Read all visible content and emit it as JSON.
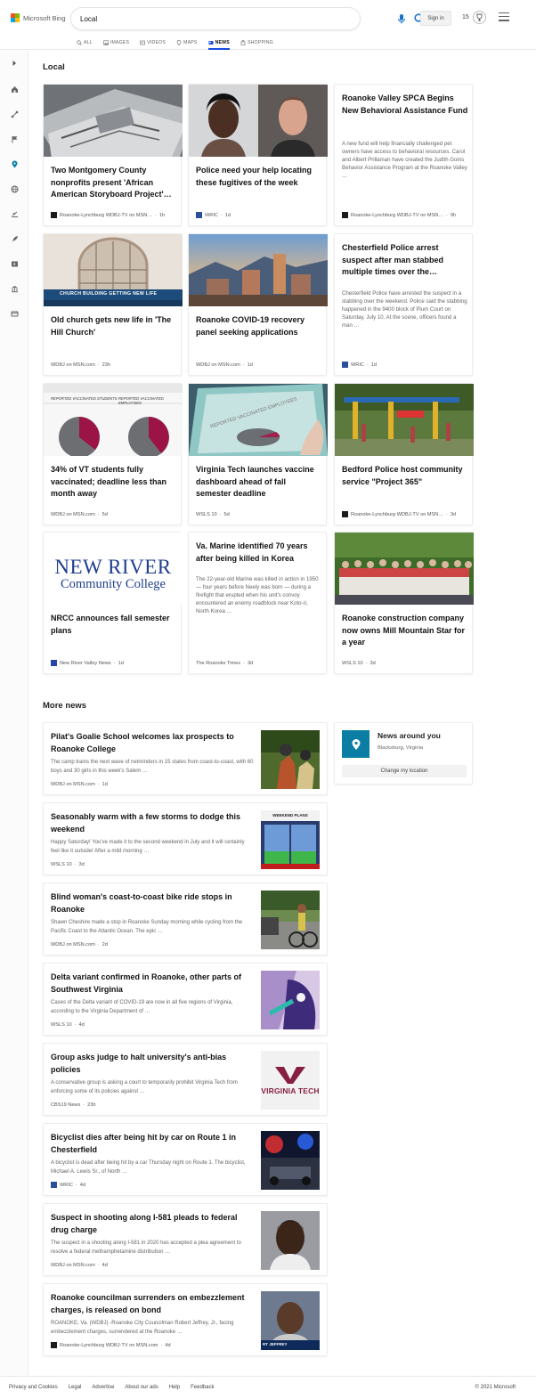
{
  "brand": {
    "name": "Microsoft Bing"
  },
  "search": {
    "query": "Local"
  },
  "header": {
    "signin_label": "Sign in",
    "rewards_count": "15"
  },
  "tabs": [
    {
      "label": "ALL",
      "icon": "search-icon"
    },
    {
      "label": "IMAGES",
      "icon": "image-icon"
    },
    {
      "label": "VIDEOS",
      "icon": "video-icon"
    },
    {
      "label": "MAPS",
      "icon": "map-pin-icon"
    },
    {
      "label": "NEWS",
      "icon": "news-icon",
      "active": true
    },
    {
      "label": "SHOPPING",
      "icon": "shopping-bag-icon"
    }
  ],
  "sidebar": {
    "icons": [
      "expand-icon",
      "home-icon",
      "science-icon",
      "flag-icon",
      "location-icon",
      "globe-icon",
      "education-icon",
      "rocket-icon",
      "video-play-icon",
      "bank-icon",
      "card-icon"
    ]
  },
  "sections": {
    "local": "Local",
    "more_news": "More news"
  },
  "cards": [
    {
      "title": "Two Montgomery County nonprofits present 'African American Storyboard Project'…",
      "source": "Roanoke-Lynchburg WDBJ-TV on MSN…",
      "age": "1h"
    },
    {
      "title": "Police need your help locating these fugitives of the week",
      "source": "WRIC",
      "age": "1d"
    },
    {
      "title": "Roanoke Valley SPCA Begins New Behavioral Assistance Fund",
      "snippet": "A new fund will help financially challenged pet owners have access to behavioral resources. Carol and Albert Prillaman have created the Judith Goins Behavior Assistance Program at the Roanoke Valley …",
      "source": "Roanoke-Lynchburg WDBJ-TV on MSN…",
      "age": "9h"
    },
    {
      "title": "Old church gets new life in 'The Hill Church'",
      "source": "WDBJ on MSN.com",
      "age": "23h",
      "img_caption": "CHURCH BUILDING GETTING NEW LIFE"
    },
    {
      "title": "Roanoke COVID-19 recovery panel seeking applications",
      "source": "WDBJ on MSN.com",
      "age": "1d"
    },
    {
      "title": "Chesterfield Police arrest suspect after man stabbed multiple times over the…",
      "snippet": "Chesterfield Police have arrested the suspect in a stabbing over the weekend. Police said the stabbing happened in the 9400 block of Plum Court on Saturday, July 10. At the scene, officers found a man …",
      "source": "WRIC",
      "age": "1d"
    },
    {
      "title": "34% of VT students fully vaccinated; deadline less than month away",
      "source": "WDBJ on MSN.com",
      "age": "5d",
      "img_label_a": "REPORTED VACCINATED STUDENTS",
      "img_label_b": "REPORTED VACCINATED EMPLOYEES"
    },
    {
      "title": "Virginia Tech launches vaccine dashboard ahead of fall semester deadline",
      "source": "WSLS 10",
      "age": "5d",
      "img_label": "REPORTED VACCINATED EMPLOYEES"
    },
    {
      "title": "Bedford Police host community service \"Project 365\"",
      "source": "Roanoke-Lynchburg WDBJ-TV on MSN…",
      "age": "3d"
    },
    {
      "title": "NRCC announces fall semester plans",
      "source": "New River Valley News",
      "age": "1d",
      "logo_line1": "NEW RIVER",
      "logo_line2": "Community College"
    },
    {
      "title": "Va. Marine identified 70 years after being killed in Korea",
      "snippet": "The 22-year-old Marine was killed in action in 1950 — four years before Neely was born — during a firefight that erupted when his unit's convoy encountered an enemy roadblock near Koto-ri, North Korea …",
      "source": "The Roanoke Times",
      "age": "3d"
    },
    {
      "title": "Roanoke construction company now owns Mill Mountain Star for a year",
      "source": "WSLS 10",
      "age": "3d"
    }
  ],
  "more_news": [
    {
      "title": "Pilat's Goalie School welcomes lax prospects to Roanoke College",
      "snippet": "The camp trains the next wave of netminders in 15 states from coast-to-coast, with 60 boys and 30 girls in this week's Salem …",
      "source": "WDBJ on MSN.com",
      "age": "1d"
    },
    {
      "title": "Seasonably warm with a few storms to dodge this weekend",
      "snippet": "Happy Saturday! You've made it to the second weekend in July and it will certainly feel like it outside! After a mild morning …",
      "source": "WSLS 10",
      "age": "3d",
      "thumb_label": "WEEKEND PLANS"
    },
    {
      "title": "Blind woman's coast-to-coast bike ride stops in Roanoke",
      "snippet": "Shawn Cheshire made a stop in Roanoke Sunday morning while cycling from the Pacific Coast to the Atlantic Ocean. The epic …",
      "source": "WDBJ on MSN.com",
      "age": "2d"
    },
    {
      "title": "Delta variant confirmed in Roanoke, other parts of Southwest Virginia",
      "snippet": "Cases of the Delta variant of COVID-19 are now in all five regions of Virginia, according to the Virginia Department of …",
      "source": "WSLS 10",
      "age": "4d"
    },
    {
      "title": "Group asks judge to halt university's anti-bias policies",
      "snippet": "A conservative group is asking a court to temporarily prohibit Virginia Tech from enforcing some of its policies against …",
      "source": "CBS19 News",
      "age": "23h",
      "thumb_label": "VIRGINIA TECH"
    },
    {
      "title": "Bicyclist dies after being hit by car on Route 1 in Chesterfield",
      "snippet": "A bicyclist is dead after being hit by a car Thursday night on Route 1. The bicyclist, Michael A. Lewis Sr., of North …",
      "source": "WRIC",
      "age": "4d"
    },
    {
      "title": "Suspect in shooting along I-581 pleads to federal drug charge",
      "snippet": "The suspect in a shooting along I-581 in 2020 has accepted a plea agreement to resolve a federal methamphetamine distribution …",
      "source": "WDBJ on MSN.com",
      "age": "4d"
    },
    {
      "title": "Roanoke councilman surrenders on embezzlement charges, is released on bond",
      "snippet": "ROANOKE, Va. (WDBJ) -Roanoke City Councilman Robert Jeffrey, Jr., facing embezzlement charges, surrendered at the Roanoke …",
      "source": "Roanoke-Lynchburg WDBJ-TV on MSN.com",
      "age": "4d",
      "thumb_label": "RT JEFFREY"
    }
  ],
  "news_around": {
    "title": "News around you",
    "location": "Blacksburg, Virginia",
    "button": "Change my location"
  },
  "footer": {
    "links": [
      "Privacy and Cookies",
      "Legal",
      "Advertise",
      "About our ads",
      "Help",
      "Feedback"
    ],
    "copyright": "© 2021 Microsoft"
  },
  "colors": {
    "accent": "#174ae4",
    "location_tile": "#0a7ea4"
  }
}
